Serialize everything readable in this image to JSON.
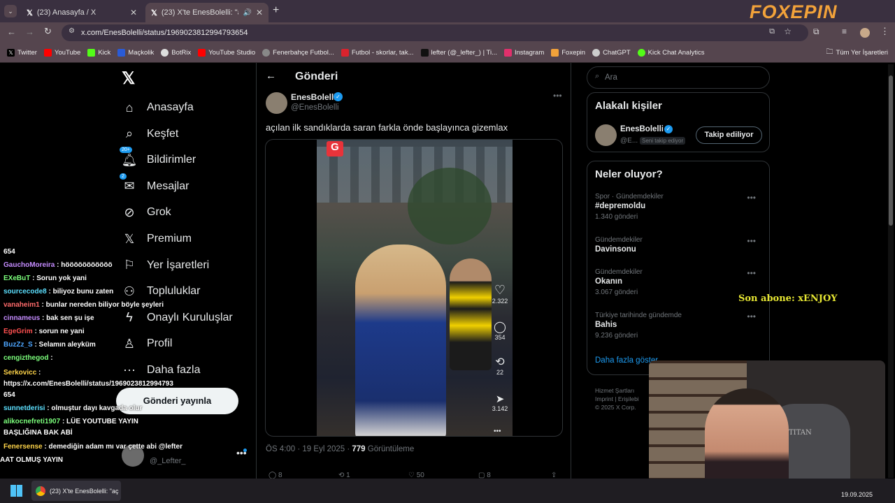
{
  "browser": {
    "tabs": [
      {
        "title": "(23) Anasayfa / X",
        "active": false
      },
      {
        "title": "(23) X'te EnesBolelli: \"açılan",
        "active": true
      }
    ],
    "url": "x.com/EnesBolelli/status/1969023812994793654",
    "bookmarks": [
      "Twitter",
      "YouTube",
      "Kick",
      "Maçkolik",
      "BotRix",
      "YouTube Studio",
      "Fenerbahçe Futbol...",
      "Futbol - skorlar, tak...",
      "lefter (@_lefter_) | Ti...",
      "Instagram",
      "Foxepin",
      "ChatGPT",
      "Kick Chat Analytics"
    ],
    "all_bookmarks": "Tüm Yer İşaretleri"
  },
  "overlay": {
    "logo": "FOXEPIN",
    "last_sub": "Son abone: xENJOY"
  },
  "sidebar": {
    "items": [
      {
        "label": "Anasayfa",
        "icon": "home-icon"
      },
      {
        "label": "Keşfet",
        "icon": "search-icon"
      },
      {
        "label": "Bildirimler",
        "icon": "bell-icon",
        "badge": "20+"
      },
      {
        "label": "Mesajlar",
        "icon": "mail-icon",
        "badge": "2"
      },
      {
        "label": "Grok",
        "icon": "grok-icon"
      },
      {
        "label": "Premium",
        "icon": "x-icon"
      },
      {
        "label": "Yer İşaretleri",
        "icon": "bookmark-icon"
      },
      {
        "label": "Topluluklar",
        "icon": "people-icon"
      },
      {
        "label": "Onaylı Kuruluşlar",
        "icon": "lightning-icon"
      },
      {
        "label": "Profil",
        "icon": "person-icon"
      },
      {
        "label": "Daha fazla",
        "icon": "more-icon"
      }
    ],
    "post_button": "Gönderi yayınla",
    "account_handle": "@_Lefter_"
  },
  "post": {
    "header_title": "Gönderi",
    "author_name": "EnesBolelli",
    "author_handle": "@EnesBolelli",
    "text": "açılan ilk sandıklarda saran farkla önde başlayınca gizemlax",
    "timestamp": "ÖS 4:00 · 19 Eyl 2025 ·",
    "views_count": "779",
    "views_label": "Görüntüleme",
    "video_actions": {
      "likes": "2.322",
      "comments": "354",
      "reposts": "22",
      "shares": "3.142"
    },
    "footer_counts": {
      "replies": "8",
      "reposts": "1",
      "likes": "50",
      "bookmarks": "8"
    }
  },
  "right": {
    "search_placeholder": "Ara",
    "relevant_title": "Alakalı kişiler",
    "relevant_person": {
      "name": "EnesBolelli",
      "handle": "@E...",
      "follows_you": "Seni takip ediyor",
      "button": "Takip ediliyor"
    },
    "trends_title": "Neler oluyor?",
    "trends": [
      {
        "category": "Spor · Gündemdekiler",
        "name": "#depremoldu",
        "count": "1.340 gönderi"
      },
      {
        "category": "Gündemdekiler",
        "name": "Davinsonu",
        "count": ""
      },
      {
        "category": "Gündemdekiler",
        "name": "Okanın",
        "count": "3.067 gönderi"
      },
      {
        "category": "Türkiye tarihinde gündemde",
        "name": "Bahis",
        "count": "9.236 gönderi"
      }
    ],
    "show_more": "Daha fazla göster",
    "footer": [
      "Hizmet Şartları",
      "Imprint",
      "Erişilebi",
      "© 2025 X Corp."
    ]
  },
  "chat": [
    {
      "user": "",
      "text": "654",
      "color": "#ffffff"
    },
    {
      "user": "GauchoMoreira",
      "text": ": hööööööööööö",
      "color": "#c58cff"
    },
    {
      "user": "EXeBuT",
      "text": ": Sorun yok yani",
      "color": "#7cff7c"
    },
    {
      "user": "sourcecode8",
      "text": ": biliyoz bunu zaten",
      "color": "#5ce0ff"
    },
    {
      "user": "vanaheim1",
      "text": ": bunlar nereden biliyor böyle şeyleri",
      "color": "#ff6b6b"
    },
    {
      "user": "cinnameus",
      "text": ": bak sen şu işe",
      "color": "#c58cff"
    },
    {
      "user": "EgeGrim",
      "text": ": sorun ne yani",
      "color": "#ff5050"
    },
    {
      "user": "BuzZz_S",
      "text": ": Selamın aleyküm",
      "color": "#4da6ff"
    },
    {
      "user": "cengizthegod",
      "text": ":",
      "color": "#7cff7c"
    },
    {
      "user": "Serkovicc",
      "text": ":",
      "color": "#ffd54a"
    },
    {
      "user": "",
      "text": "https://x.com/EnesBolelli/status/1969023812994793",
      "color": "#ffffff"
    },
    {
      "user": "",
      "text": "654",
      "color": "#ffffff"
    },
    {
      "user": "sunnetderisi",
      "text": ": olmuştur dayı kavgada olur",
      "color": "#5ce0ff"
    },
    {
      "user": "alikocnefreti1907",
      "text": ": LÜE YOUTUBE YAYIN",
      "color": "#7cff7c"
    },
    {
      "user": "",
      "text": "BAŞLIĞINA BAK ABİ",
      "color": "#ffffff"
    },
    {
      "user": "Fenersense",
      "text": ": demediğin adam mı var çette abi @lefter",
      "color": "#ffd54a"
    },
    {
      "user": "",
      "text": "AAT OLMUŞ YAYIN",
      "color": "#ffffff"
    }
  ],
  "taskbar": {
    "app_title": "(23) X'te EnesBolelli: \"aç",
    "date": "19.09.2025"
  },
  "colors": {
    "accent": "#1d9bf0",
    "chrome_bg": "#55454e",
    "tab_bg": "#3a3040"
  }
}
